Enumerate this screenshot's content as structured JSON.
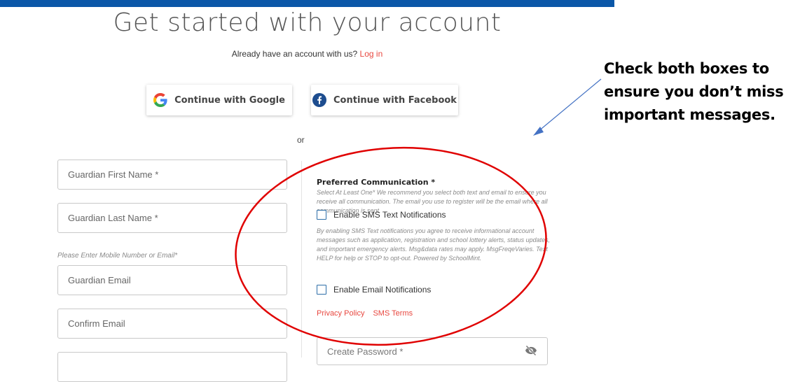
{
  "header": {
    "title": "Get started with your account",
    "login_prompt": "Already have an account with us?",
    "login_link": "Log in"
  },
  "social": {
    "google_label": "Continue with Google",
    "facebook_label": "Continue with Facebook"
  },
  "divider_text": "or",
  "form": {
    "first_name_placeholder": "Guardian First Name *",
    "last_name_placeholder": "Guardian Last Name *",
    "mobile_hint": "Please Enter Mobile Number or Email*",
    "email_placeholder": "Guardian Email",
    "confirm_email_placeholder": "Confirm Email",
    "password_placeholder": "Create Password *"
  },
  "communication": {
    "title": "Preferred Communication *",
    "description": "Select At Least One* We recommend you select both text and email to ensure you receive all communication. The email you use to register will be the email where all communication is sent.",
    "sms_label": "Enable SMS Text Notifications",
    "sms_checked": false,
    "sms_description": "By enabling SMS Text notifications you agree to receive informational account messages such as application, registration and school lottery alerts, status updates, and important emergency alerts. Msg&data rates may apply. MsgFreqeVaries. Text HELP for help or STOP to opt-out. Powered by SchoolMint.",
    "email_label": "Enable Email Notifications",
    "email_checked": false,
    "privacy_link": "Privacy Policy",
    "sms_terms_link": "SMS Terms"
  },
  "annotation": {
    "text": "Check both boxes to\nensure you don’t miss\nimportant messages."
  },
  "colors": {
    "top_bar": "#0b57a8",
    "link": "#e8473f",
    "checkbox_border": "#2d6ea8",
    "annotation_ellipse": "#e00000",
    "annotation_arrow": "#4472c4"
  },
  "icons": {
    "google": "google-g-icon",
    "facebook": "facebook-f-icon",
    "password_toggle": "eye-slash-icon"
  }
}
